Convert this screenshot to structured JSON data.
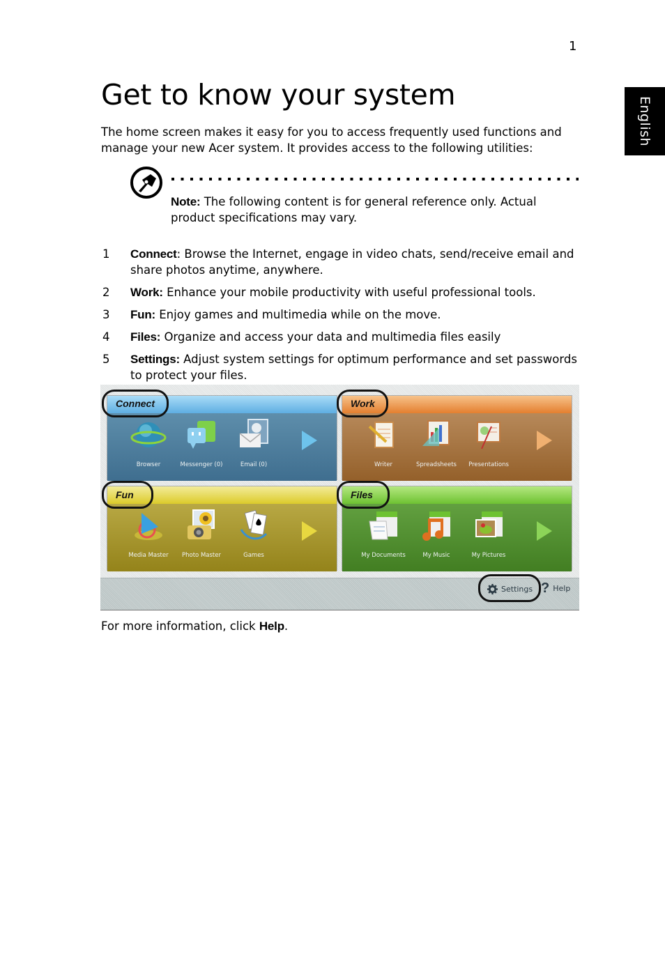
{
  "page_number": "1",
  "language_tab": "English",
  "title": "Get to know your system",
  "intro": "The home screen makes it easy for you to access frequently used functions and manage your new Acer system. It provides access to the following utilities:",
  "note": {
    "icon": "pen-nib-icon",
    "label": "Note:",
    "text": " The following content is for general reference only. Actual product specifications may vary."
  },
  "utilities": [
    {
      "num": "1",
      "label": "Connect",
      "text": ": Browse the Internet, engage in video chats, send/receive email and share photos anytime, anywhere."
    },
    {
      "num": "2",
      "label": "Work:",
      "text": " Enhance your mobile productivity with useful professional tools."
    },
    {
      "num": "3",
      "label": "Fun:",
      "text": " Enjoy games and multimedia while on the move."
    },
    {
      "num": "4",
      "label": "Files:",
      "text": " Organize and access your data and multimedia files easily"
    },
    {
      "num": "5",
      "label": "Settings:",
      "text": " Adjust system settings for optimum performance and set passwords to protect your files."
    }
  ],
  "home_screen": {
    "panels": [
      {
        "name": "Connect",
        "colors": {
          "header": "#7cc3ec",
          "body": "#4f7f9f",
          "arrow": "#6ec3ec"
        },
        "apps": [
          {
            "label": "Browser",
            "icon": "globe-icon"
          },
          {
            "label": "Messenger (0)",
            "icon": "chat-bubbles-icon"
          },
          {
            "label": "Email (0)",
            "icon": "envelope-owl-icon"
          }
        ]
      },
      {
        "name": "Work",
        "colors": {
          "header": "#f0a15a",
          "body": "#a46b35",
          "arrow": "#f0b070"
        },
        "apps": [
          {
            "label": "Writer",
            "icon": "notepad-pencil-icon"
          },
          {
            "label": "Spreadsheets",
            "icon": "chart-ruler-icon"
          },
          {
            "label": "Presentations",
            "icon": "easel-icon"
          }
        ]
      },
      {
        "name": "Fun",
        "colors": {
          "header": "#e6d84c",
          "body": "#a89624",
          "arrow": "#e8d840"
        },
        "apps": [
          {
            "label": "Media Master",
            "icon": "play-media-icon"
          },
          {
            "label": "Photo Master",
            "icon": "camera-sunflower-icon"
          },
          {
            "label": "Games",
            "icon": "playing-cards-icon"
          }
        ]
      },
      {
        "name": "Files",
        "colors": {
          "header": "#88d24c",
          "body": "#4f902e",
          "arrow": "#8cd458"
        },
        "apps": [
          {
            "label": "My Documents",
            "icon": "documents-folder-icon"
          },
          {
            "label": "My Music",
            "icon": "music-folder-icon"
          },
          {
            "label": "My Pictures",
            "icon": "pictures-folder-icon"
          }
        ]
      }
    ],
    "settings_label": "Settings",
    "help_label": "Help",
    "help_glyph": "?"
  },
  "outro": {
    "prefix": "For more information, click ",
    "link": "Help",
    "suffix": "."
  }
}
